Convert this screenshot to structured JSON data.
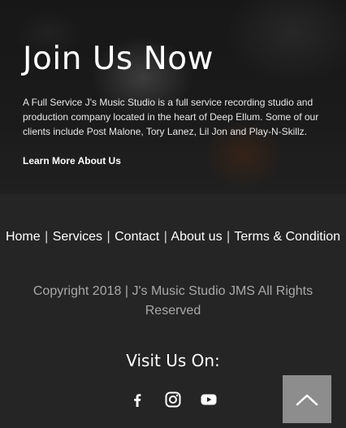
{
  "hero": {
    "title": "Join Us Now",
    "description": "A Full Service J's Music Studio is a full service recording studio and production company located in the heart of Deep Ellum. Some of our clients include Post Malone, Tory Lanez, Lil Jon and Play-N-Skillz.",
    "link_label": "Learn More About Us"
  },
  "footer": {
    "nav": {
      "home": "Home",
      "services": "Services",
      "contact": "Contact",
      "about": "About us",
      "terms": "Terms & Condition",
      "separator": "|"
    },
    "copyright": "Copyright 2018 | J's Music Studio JMS All Rights Reserved",
    "visit_title": "Visit Us On:",
    "social": [
      "facebook-icon",
      "instagram-icon",
      "youtube-icon"
    ]
  },
  "back_to_top": {
    "icon": "chevron-up-icon"
  },
  "colors": {
    "background": "#252525",
    "back_to_top": "#8d8d8d",
    "copyright_text": "#a8a8a8"
  }
}
